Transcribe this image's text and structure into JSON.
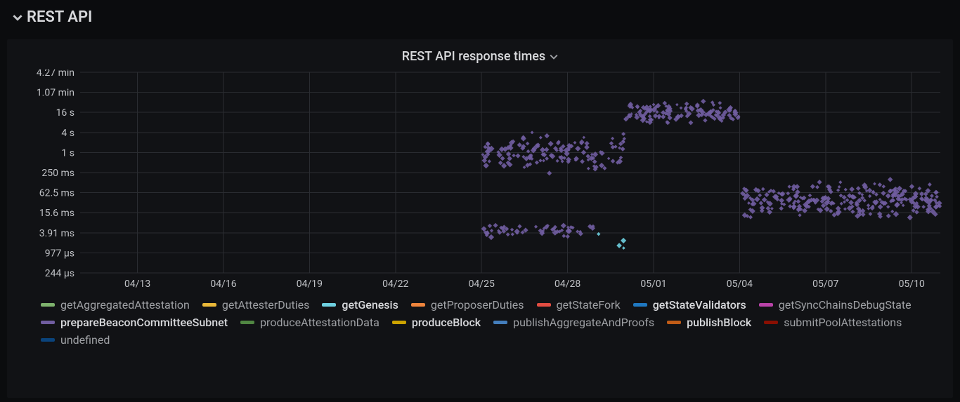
{
  "section_title": "REST API",
  "panel": {
    "title": "REST API response times"
  },
  "chart_data": {
    "type": "scatter",
    "xlabel": "",
    "ylabel": "",
    "yscale": "log",
    "x_ticks": [
      "04/13",
      "04/16",
      "04/19",
      "04/22",
      "04/25",
      "04/28",
      "05/01",
      "05/04",
      "05/07",
      "05/10"
    ],
    "y_ticks": [
      "244 µs",
      "977 µs",
      "3.91 ms",
      "15.6 ms",
      "62.5 ms",
      "250 ms",
      "1 s",
      "4 s",
      "16 s",
      "1.07 min",
      "4.27 min"
    ],
    "x_range": [
      "04/11",
      "05/11"
    ],
    "clusters": [
      {
        "series": "prepareBeaconCommitteeSubnet",
        "x_from": "04/25",
        "x_to": "04/30",
        "y_center": "1 s",
        "y_spread_stops": 1.1,
        "n": 130
      },
      {
        "series": "prepareBeaconCommitteeSubnet",
        "x_from": "04/25",
        "x_to": "04/29",
        "y_center": "4.5 ms",
        "y_spread_stops": 0.35,
        "n": 55
      },
      {
        "series": "prepareBeaconCommitteeSubnet",
        "x_from": "04/30",
        "x_to": "05/04",
        "y_center": "16 s",
        "y_spread_stops": 0.6,
        "n": 120
      },
      {
        "series": "prepareBeaconCommitteeSubnet",
        "x_from": "05/04",
        "x_to": "05/11",
        "y_center": "40 ms",
        "y_spread_stops": 1.0,
        "n": 260
      },
      {
        "series": "getGenesis",
        "x_from": "04/29",
        "x_to": "04/30",
        "y_center": "2 ms",
        "y_spread_stops": 0.6,
        "n": 4
      }
    ],
    "legend": {
      "active": [
        "getGenesis",
        "getStateValidators",
        "prepareBeaconCommitteeSubnet",
        "produceBlock",
        "publishBlock"
      ],
      "items": [
        {
          "name": "getAggregatedAttestation",
          "color": "#7eb26d"
        },
        {
          "name": "getAttesterDuties",
          "color": "#eab839"
        },
        {
          "name": "getGenesis",
          "color": "#6ed0e0"
        },
        {
          "name": "getProposerDuties",
          "color": "#ef843c"
        },
        {
          "name": "getStateFork",
          "color": "#e24d42"
        },
        {
          "name": "getStateValidators",
          "color": "#1f78c1"
        },
        {
          "name": "getSyncChainsDebugState",
          "color": "#ba43a9"
        },
        {
          "name": "prepareBeaconCommitteeSubnet",
          "color": "#705da0"
        },
        {
          "name": "produceAttestationData",
          "color": "#508642"
        },
        {
          "name": "produceBlock",
          "color": "#cca300"
        },
        {
          "name": "publishAggregateAndProofs",
          "color": "#447ebc"
        },
        {
          "name": "publishBlock",
          "color": "#c15c17"
        },
        {
          "name": "submitPoolAttestations",
          "color": "#890f02"
        },
        {
          "name": "undefined",
          "color": "#0a437c"
        }
      ]
    }
  }
}
